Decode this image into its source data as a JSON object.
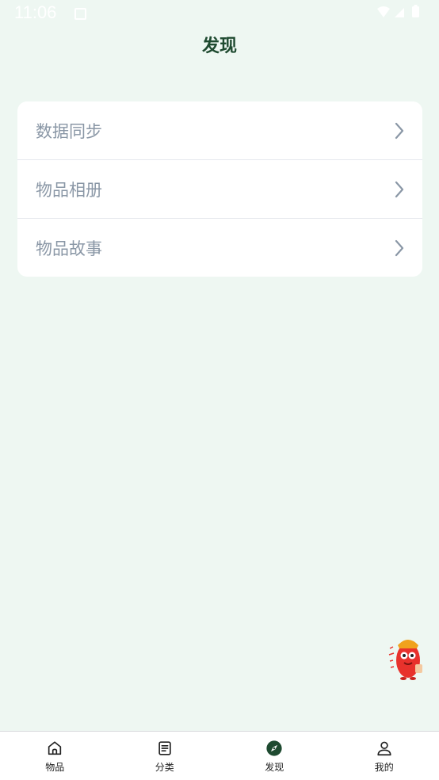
{
  "status_bar": {
    "time": "11:06",
    "icons": [
      "notification-icon",
      "wifi-icon",
      "signal-icon",
      "battery-icon"
    ]
  },
  "header": {
    "title": "发现"
  },
  "menu": {
    "items": [
      {
        "label": "数据同步",
        "icon": "chevron-right-icon"
      },
      {
        "label": "物品相册",
        "icon": "chevron-right-icon"
      },
      {
        "label": "物品故事",
        "icon": "chevron-right-icon"
      }
    ]
  },
  "floating_widget": {
    "icon": "mascot-icon"
  },
  "bottom_nav": {
    "items": [
      {
        "label": "物品",
        "icon": "home-icon",
        "active": false
      },
      {
        "label": "分类",
        "icon": "list-icon",
        "active": false
      },
      {
        "label": "发现",
        "icon": "compass-icon",
        "active": true
      },
      {
        "label": "我的",
        "icon": "user-icon",
        "active": false
      }
    ]
  },
  "colors": {
    "background": "#eef7f2",
    "title": "#1e4a30",
    "menu_text": "#8a97a6",
    "active_icon": "#1e4a30",
    "card": "#ffffff"
  }
}
